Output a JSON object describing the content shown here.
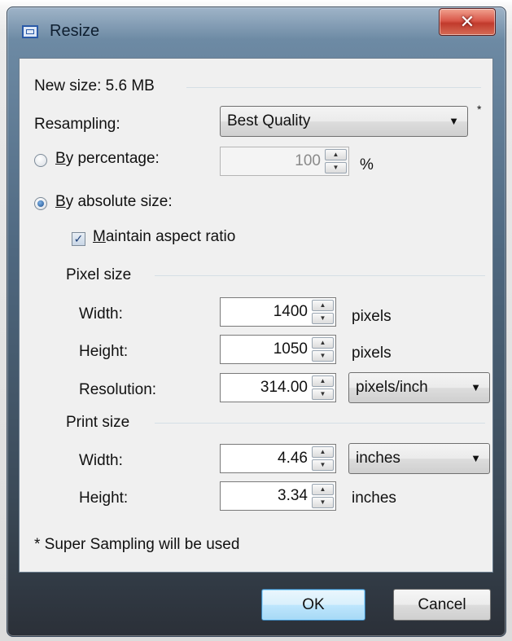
{
  "window": {
    "title": "Resize",
    "close_glyph": "✕"
  },
  "new_size": {
    "label": "New size: 5.6 MB"
  },
  "resampling": {
    "label": "Resampling:",
    "value": "Best Quality",
    "marker": "*"
  },
  "by_percentage": {
    "label": "By percentage:",
    "selected": false,
    "value": "100",
    "unit": "%"
  },
  "by_absolute": {
    "label": "By absolute size:",
    "selected": true
  },
  "maintain_aspect": {
    "label": "Maintain aspect ratio",
    "checked": true
  },
  "pixel_size": {
    "header": "Pixel size",
    "width": {
      "label": "Width:",
      "value": "1400",
      "unit": "pixels"
    },
    "height": {
      "label": "Height:",
      "value": "1050",
      "unit": "pixels"
    },
    "resolution": {
      "label": "Resolution:",
      "value": "314.00",
      "unit": "pixels/inch"
    }
  },
  "print_size": {
    "header": "Print size",
    "width": {
      "label": "Width:",
      "value": "4.46",
      "unit": "inches"
    },
    "height": {
      "label": "Height:",
      "value": "3.34",
      "unit": "inches"
    }
  },
  "note": "* Super Sampling will be used",
  "buttons": {
    "ok": "OK",
    "cancel": "Cancel"
  }
}
